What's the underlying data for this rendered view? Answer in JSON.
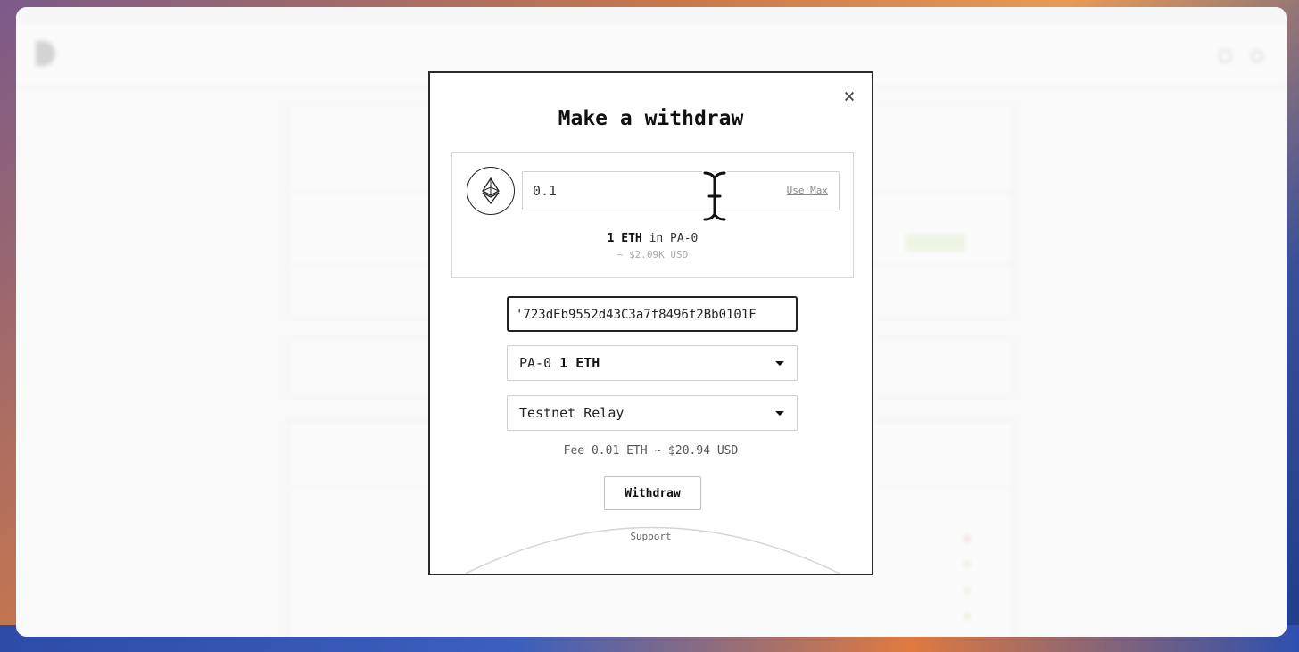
{
  "modal": {
    "title": "Make a withdraw",
    "close_symbol": "×",
    "asset_icon": "ethereum-icon",
    "amount_value": "0.1",
    "use_max_label": "Use Max",
    "balance_amount": "1 ETH",
    "balance_account": "in PA-0",
    "balance_usd": "~ $2.09K USD",
    "address_value": "'723dEb9552d43C3a7f8496f2Bb0101F",
    "account_select": {
      "account": "PA-0",
      "amount": "1 ETH"
    },
    "relay_select": {
      "value": "Testnet Relay"
    },
    "fee_text": "Fee 0.01 ETH ~ $20.94 USD",
    "withdraw_label": "Withdraw",
    "support_label": "Support"
  }
}
